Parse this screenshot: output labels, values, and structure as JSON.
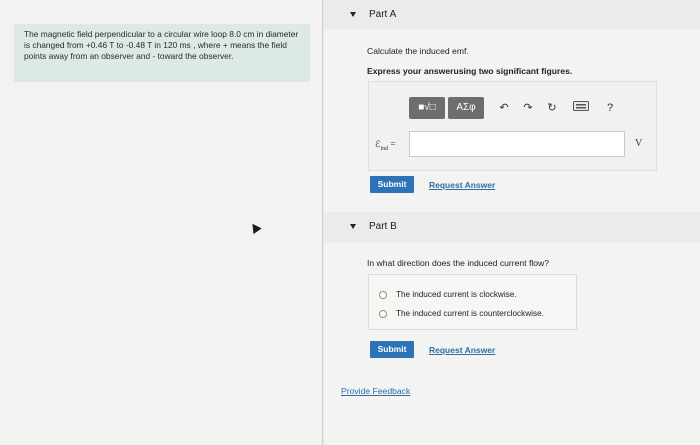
{
  "problem": {
    "text": "The magnetic field perpendicular to a circular wire loop 8.0 cm in diameter is changed from +0.46 T to -0.48 T in 120 ms , where + means the field points away from an observer and - toward the observer."
  },
  "part_a": {
    "title": "Part A",
    "prompt": "Calculate the induced emf.",
    "instruction": "Express your answerusing two significant figures.",
    "toolbar": {
      "btn_template": "■√□",
      "btn_greek": "ΑΣφ"
    },
    "emf_symbol": "ℰ",
    "emf_subscript": "ind",
    "emf_equals": "=",
    "unit": "V",
    "submit": "Submit",
    "request_answer": "Request Answer"
  },
  "part_b": {
    "title": "Part B",
    "prompt": "In what direction does the induced current flow?",
    "choices": [
      "The induced current is clockwise.",
      "The induced current is counterclockwise."
    ],
    "submit": "Submit",
    "request_answer": "Request Answer"
  },
  "feedback": "Provide Feedback"
}
